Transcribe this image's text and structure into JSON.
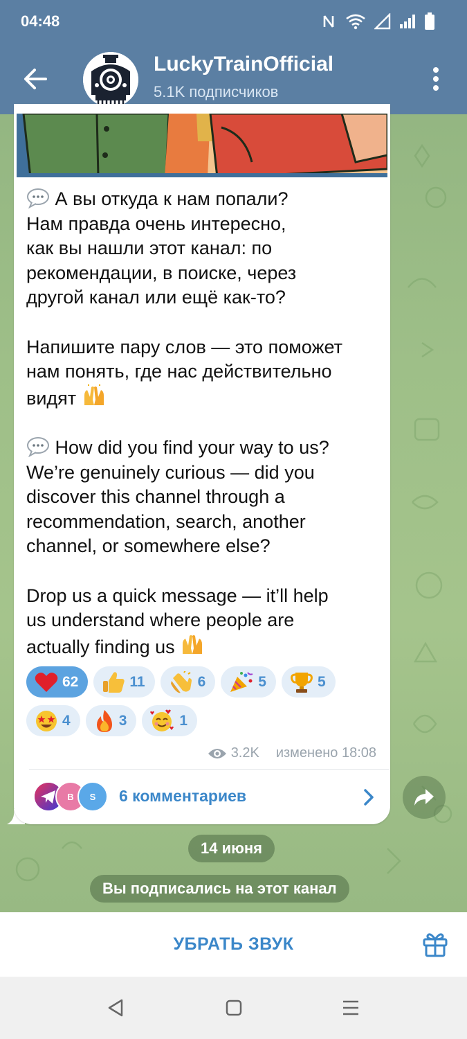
{
  "status_bar": {
    "time": "04:48"
  },
  "header": {
    "title": "LuckyTrainOfficial",
    "subtitle": "5.1K подписчиков"
  },
  "post": {
    "paragraphs_ru": [
      "А вы откуда к нам попали? Нам правда очень интересно, как вы нашли этот канал: по рекомендации, в поиске, через другой канал или ещё как-то?",
      "Напишите пару слов — это поможет нам понять, где нас действительно видят"
    ],
    "paragraphs_en": [
      "How did you find your way to us? We’re genuinely curious — did you discover this channel through a recommendation, search, another channel, or somewhere else?",
      "Drop us a quick message — it’ll help us understand where people are actually finding us"
    ],
    "lines": [
      "А вы откуда к нам попали?",
      "Нам правда очень интересно,",
      "как вы нашли этот канал: по",
      "рекомендации, в поиске, через",
      "другой канал или ещё как-то?",
      "Напишите пару слов — это поможет",
      "нам понять, где нас действительно",
      "видят",
      "How did you find your way to us?",
      "We’re genuinely curious — did you",
      "discover this channel through a",
      "recommendation, search, another",
      "channel, or somewhere else?",
      "Drop us a quick message — it’ll help",
      "us understand where people are",
      "actually finding us"
    ],
    "reactions": [
      {
        "icon": "heart-icon",
        "count": "62",
        "active": true
      },
      {
        "icon": "thumbs-up-icon",
        "count": "11",
        "active": false
      },
      {
        "icon": "clapping-hands-icon",
        "count": "6",
        "active": false
      },
      {
        "icon": "party-popper-icon",
        "count": "5",
        "active": false
      },
      {
        "icon": "trophy-icon",
        "count": "5",
        "active": false
      },
      {
        "icon": "star-struck-icon",
        "count": "4",
        "active": false
      },
      {
        "icon": "fire-icon",
        "count": "3",
        "active": false
      },
      {
        "icon": "smiling-face-hearts-icon",
        "count": "1",
        "active": false
      }
    ],
    "views": "3.2K",
    "edited": "изменено 18:08",
    "comments_label": "6 комментариев",
    "comment_avatars": [
      "B",
      "S"
    ]
  },
  "service": {
    "date": "14 июня",
    "subscribed": "Вы подписались на этот канал"
  },
  "bottom": {
    "mute_label": "УБРАТЬ ЗВУК"
  },
  "colors": {
    "header": "#5b7fa3",
    "accent": "#3b87c9",
    "reaction_bg": "#e4eef8",
    "reaction_active": "#5ca3e0"
  }
}
